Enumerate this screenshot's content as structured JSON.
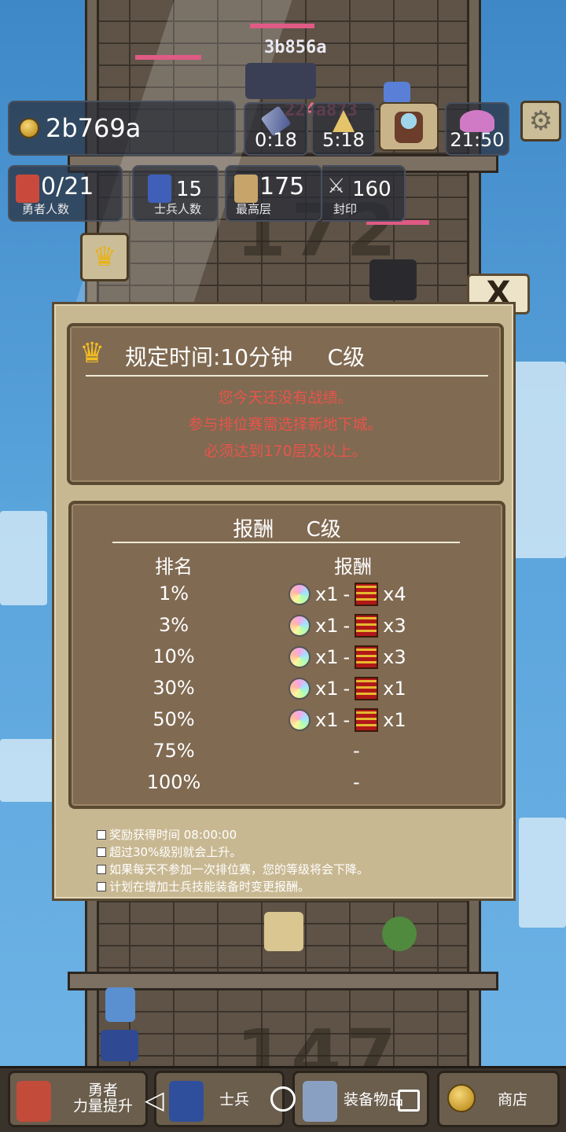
{
  "hud": {
    "gold": "2b769a",
    "timers": [
      "0:18",
      "5:18",
      "",
      "21:50"
    ],
    "stats": [
      {
        "value": "0/21",
        "label": "勇者人数"
      },
      {
        "value": "15",
        "label": "士兵人数"
      },
      {
        "value": "175",
        "label": "最高层"
      },
      {
        "value": "160",
        "label": "封印"
      }
    ],
    "settings_icon": "gear-icon"
  },
  "battle": {
    "enemy_hp": "3b856a",
    "damage": "224a873"
  },
  "floors": {
    "upper": "172",
    "lower": "147"
  },
  "dialog": {
    "close_label": "X",
    "rule_title": "规定时间:10分钟     C级",
    "warnings": [
      "您今天还没有战绩。",
      "参与排位赛需选择新地下城。",
      "必须达到170层及以上。"
    ],
    "reward_title": "报酬     C级",
    "col_rank": "排名",
    "col_reward": "报酬",
    "rows": [
      {
        "rank": "1%",
        "gem": "x1",
        "sep": "-",
        "chest": "x4"
      },
      {
        "rank": "3%",
        "gem": "x1",
        "sep": "-",
        "chest": "x3"
      },
      {
        "rank": "10%",
        "gem": "x1",
        "sep": "-",
        "chest": "x3"
      },
      {
        "rank": "30%",
        "gem": "x1",
        "sep": "-",
        "chest": "x1"
      },
      {
        "rank": "50%",
        "gem": "x1",
        "sep": "-",
        "chest": "x1"
      },
      {
        "rank": "75%",
        "none": "-"
      },
      {
        "rank": "100%",
        "none": "-"
      }
    ],
    "notes": [
      "奖励获得时间 08:00:00",
      "超过30%级别就会上升。",
      "如果每天不参加一次排位赛，您的等级将会下降。",
      "计划在增加士兵技能装备时变更报酬。"
    ]
  },
  "nav": {
    "heroes": "勇者\n力量提升",
    "soldiers": "士兵",
    "equipment": "装备物品",
    "shop": "商店"
  },
  "colors": {
    "warning": "#e8544a",
    "panel": "#806a52",
    "frame": "#c8b892"
  }
}
